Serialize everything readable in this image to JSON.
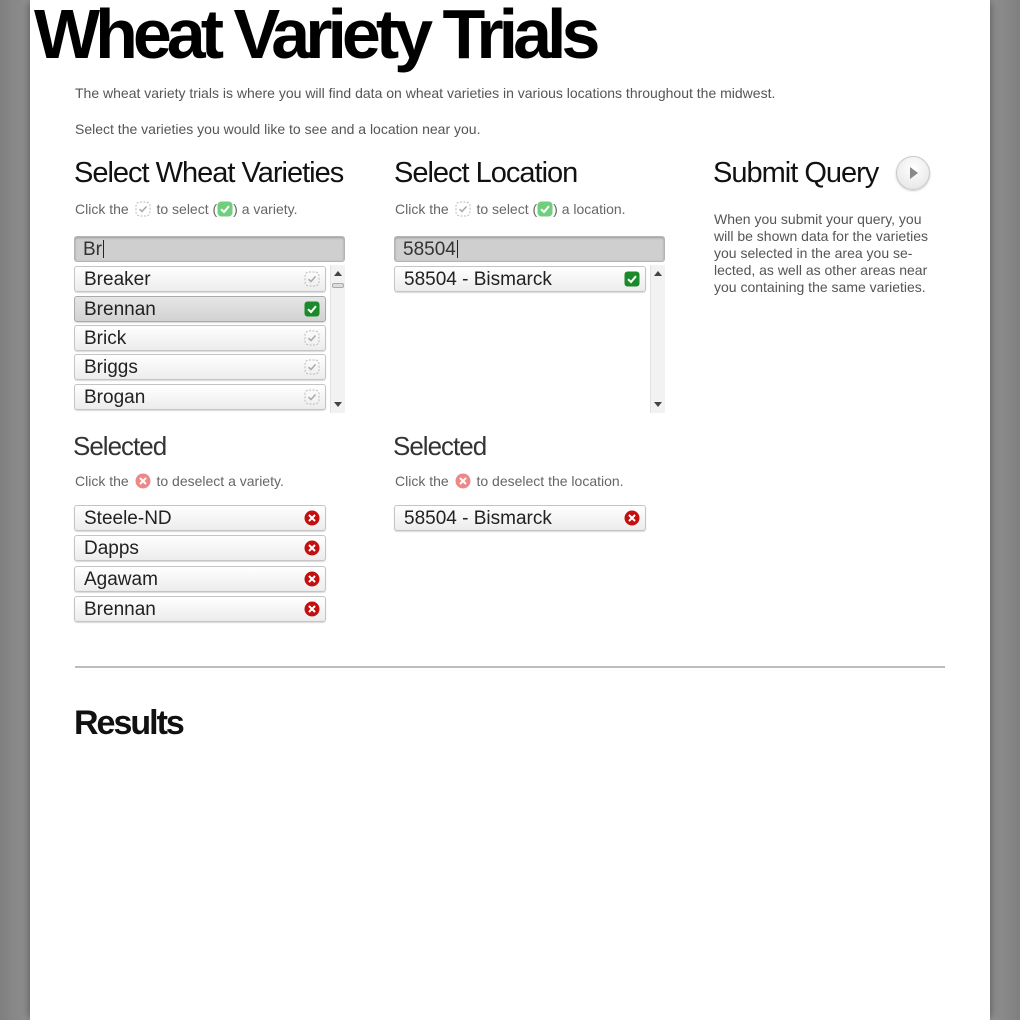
{
  "header": {
    "title": "Wheat Variety Trials"
  },
  "intro": {
    "line1": "The wheat variety trials is where you will find data on wheat varieties in various locations throughout the midwest.",
    "line2": "Select the varieties you would like to see and a location near you."
  },
  "varieties": {
    "heading": "Select Wheat Varieties",
    "hint_before": "Click the",
    "hint_middle": "to select (",
    "hint_after": ") a variety.",
    "filter_value": "Br",
    "items": [
      {
        "label": "Breaker",
        "checked": false
      },
      {
        "label": "Brennan",
        "checked": true
      },
      {
        "label": "Brick",
        "checked": false
      },
      {
        "label": "Briggs",
        "checked": false
      },
      {
        "label": "Brogan",
        "checked": false
      }
    ],
    "selected_heading": "Selected",
    "selected_hint_before": "Click the",
    "selected_hint_after": "to deselect a variety.",
    "selected": [
      "Steele-ND",
      "Dapps",
      "Agawam",
      "Brennan"
    ]
  },
  "location": {
    "heading": "Select Location",
    "hint_before": "Click the",
    "hint_middle": "to select (",
    "hint_after": ") a location.",
    "filter_value": "58504",
    "items": [
      {
        "label": "58504 - Bismarck",
        "checked": true
      }
    ],
    "selected_heading": "Selected",
    "selected_hint_before": "Click the",
    "selected_hint_after": "to deselect the location.",
    "selected": [
      "58504 - Bismarck"
    ]
  },
  "submit": {
    "heading": "Submit Query",
    "description": "When you submit your query, you will be shown data for the varieties you selected in the area you se-lected, as well as other areas near you containing the same varieties."
  },
  "results": {
    "heading": "Results"
  },
  "icons": {
    "check_unchecked": "check-outline-icon",
    "check_checked": "check-green-icon",
    "remove": "remove-x-icon",
    "submit": "play-arrow-icon"
  },
  "colors": {
    "check_green": "#1a8a2a",
    "remove_red": "#c21010"
  }
}
